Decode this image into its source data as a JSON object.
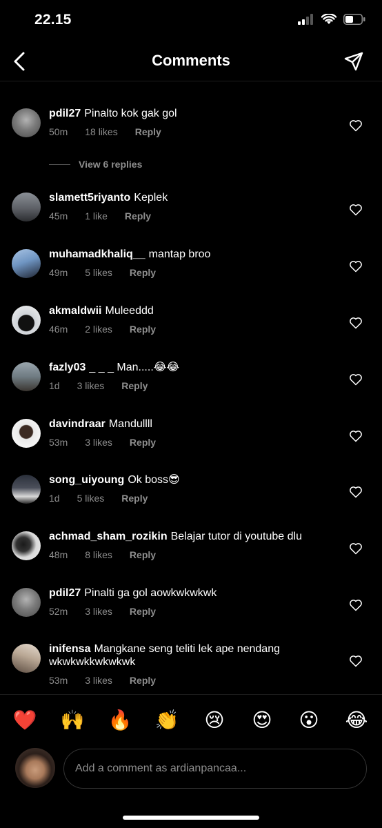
{
  "status": {
    "time": "22.15"
  },
  "header": {
    "title": "Comments",
    "back_icon": "chevron-left-icon",
    "send_icon": "paper-plane-icon"
  },
  "comments": [
    {
      "username": "pdil27",
      "text": "Pinalto kok gak gol",
      "time": "50m",
      "likes": "18 likes",
      "reply": "Reply"
    },
    {
      "username": "slamett5riyanto",
      "text": "Keplek",
      "time": "45m",
      "likes": "1 like",
      "reply": "Reply"
    },
    {
      "username": "muhamadkhaliq__",
      "text": "mantap broo",
      "time": "49m",
      "likes": "5 likes",
      "reply": "Reply"
    },
    {
      "username": "akmaldwii",
      "text": "Muleeddd",
      "time": "46m",
      "likes": "2 likes",
      "reply": "Reply"
    },
    {
      "username": "fazly03",
      "text": "_ _ _ Man.....😂😂",
      "time": "1d",
      "likes": "3 likes",
      "reply": "Reply"
    },
    {
      "username": "davindraar",
      "text": "Mandullll",
      "time": "53m",
      "likes": "3 likes",
      "reply": "Reply"
    },
    {
      "username": "song_uiyoung",
      "text": "Ok boss😎",
      "time": "1d",
      "likes": "5 likes",
      "reply": "Reply"
    },
    {
      "username": "achmad_sham_rozikin",
      "text": "Belajar tutor di youtube dlu",
      "time": "48m",
      "likes": "8 likes",
      "reply": "Reply"
    },
    {
      "username": "pdil27",
      "text": "Pinalti ga gol aowkwkwkwk",
      "time": "52m",
      "likes": "3 likes",
      "reply": "Reply"
    },
    {
      "username": "inifensa",
      "text": "Mangkane seng teliti lek ape nendang wkwkwkkwkwkwk",
      "time": "53m",
      "likes": "3 likes",
      "reply": "Reply"
    }
  ],
  "view_replies": "View 6 replies",
  "reactions": [
    "❤️",
    "🙌",
    "🔥",
    "👏",
    "😢",
    "😍",
    "😮",
    "😂"
  ],
  "composer": {
    "placeholder": "Add a comment as ardianpancaa..."
  },
  "colors": {
    "background": "#000000",
    "secondary_text": "#8e8e8e",
    "primary_text": "#ffffff"
  }
}
